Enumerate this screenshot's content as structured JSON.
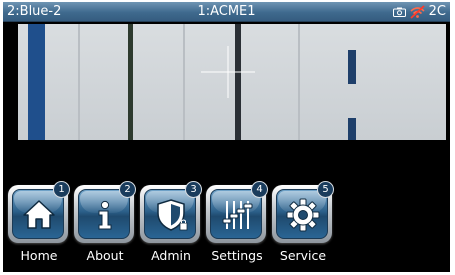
{
  "titlebar": {
    "left": "2:Blue-2",
    "center": "1:ACME1",
    "right_code": "2C",
    "camera_icon": "camera-icon",
    "signal_icon": "signal-off-icon"
  },
  "menu": {
    "items": [
      {
        "label": "Home",
        "badge": "1",
        "icon": "home-icon"
      },
      {
        "label": "About",
        "badge": "2",
        "icon": "info-icon"
      },
      {
        "label": "Admin",
        "badge": "3",
        "icon": "shield-lock-icon"
      },
      {
        "label": "Settings",
        "badge": "4",
        "icon": "sliders-icon"
      },
      {
        "label": "Service",
        "badge": "5",
        "icon": "gear-icon"
      }
    ]
  },
  "colors": {
    "title_bar": "#3f6a8e",
    "tile_blue": "#2b5f89",
    "background": "#000000"
  }
}
